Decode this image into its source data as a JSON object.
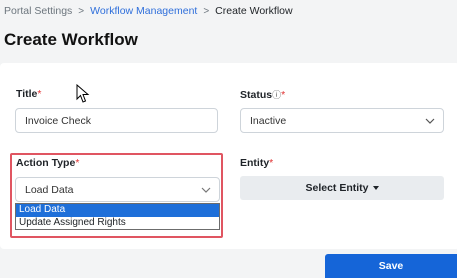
{
  "breadcrumb": {
    "items": [
      "Portal Settings",
      "Workflow Management",
      "Create Workflow"
    ],
    "separator": ">"
  },
  "page_title": "Create Workflow",
  "form": {
    "title": {
      "label": "Title",
      "required_mark": "*",
      "value": "Invoice Check"
    },
    "status": {
      "label": "Status",
      "info_icon": "ⓘ",
      "required_mark": "*",
      "value": "Inactive"
    },
    "action_type": {
      "label": "Action Type",
      "required_mark": "*",
      "value": "Load Data",
      "options": [
        "Load Data",
        "Update Assigned Rights"
      ],
      "selected_option": "Load Data"
    },
    "entity": {
      "label": "Entity",
      "required_mark": "*",
      "button_label": "Select Entity"
    }
  },
  "save_label": "Save",
  "colors": {
    "primary": "#1565d8",
    "highlight_border": "#e05561",
    "link": "#2f6fdb",
    "required": "#e03131"
  },
  "icons": [
    "chevron-right-icon",
    "chevron-down-icon",
    "info-icon",
    "caret-down-icon",
    "mouse-cursor-icon"
  ]
}
